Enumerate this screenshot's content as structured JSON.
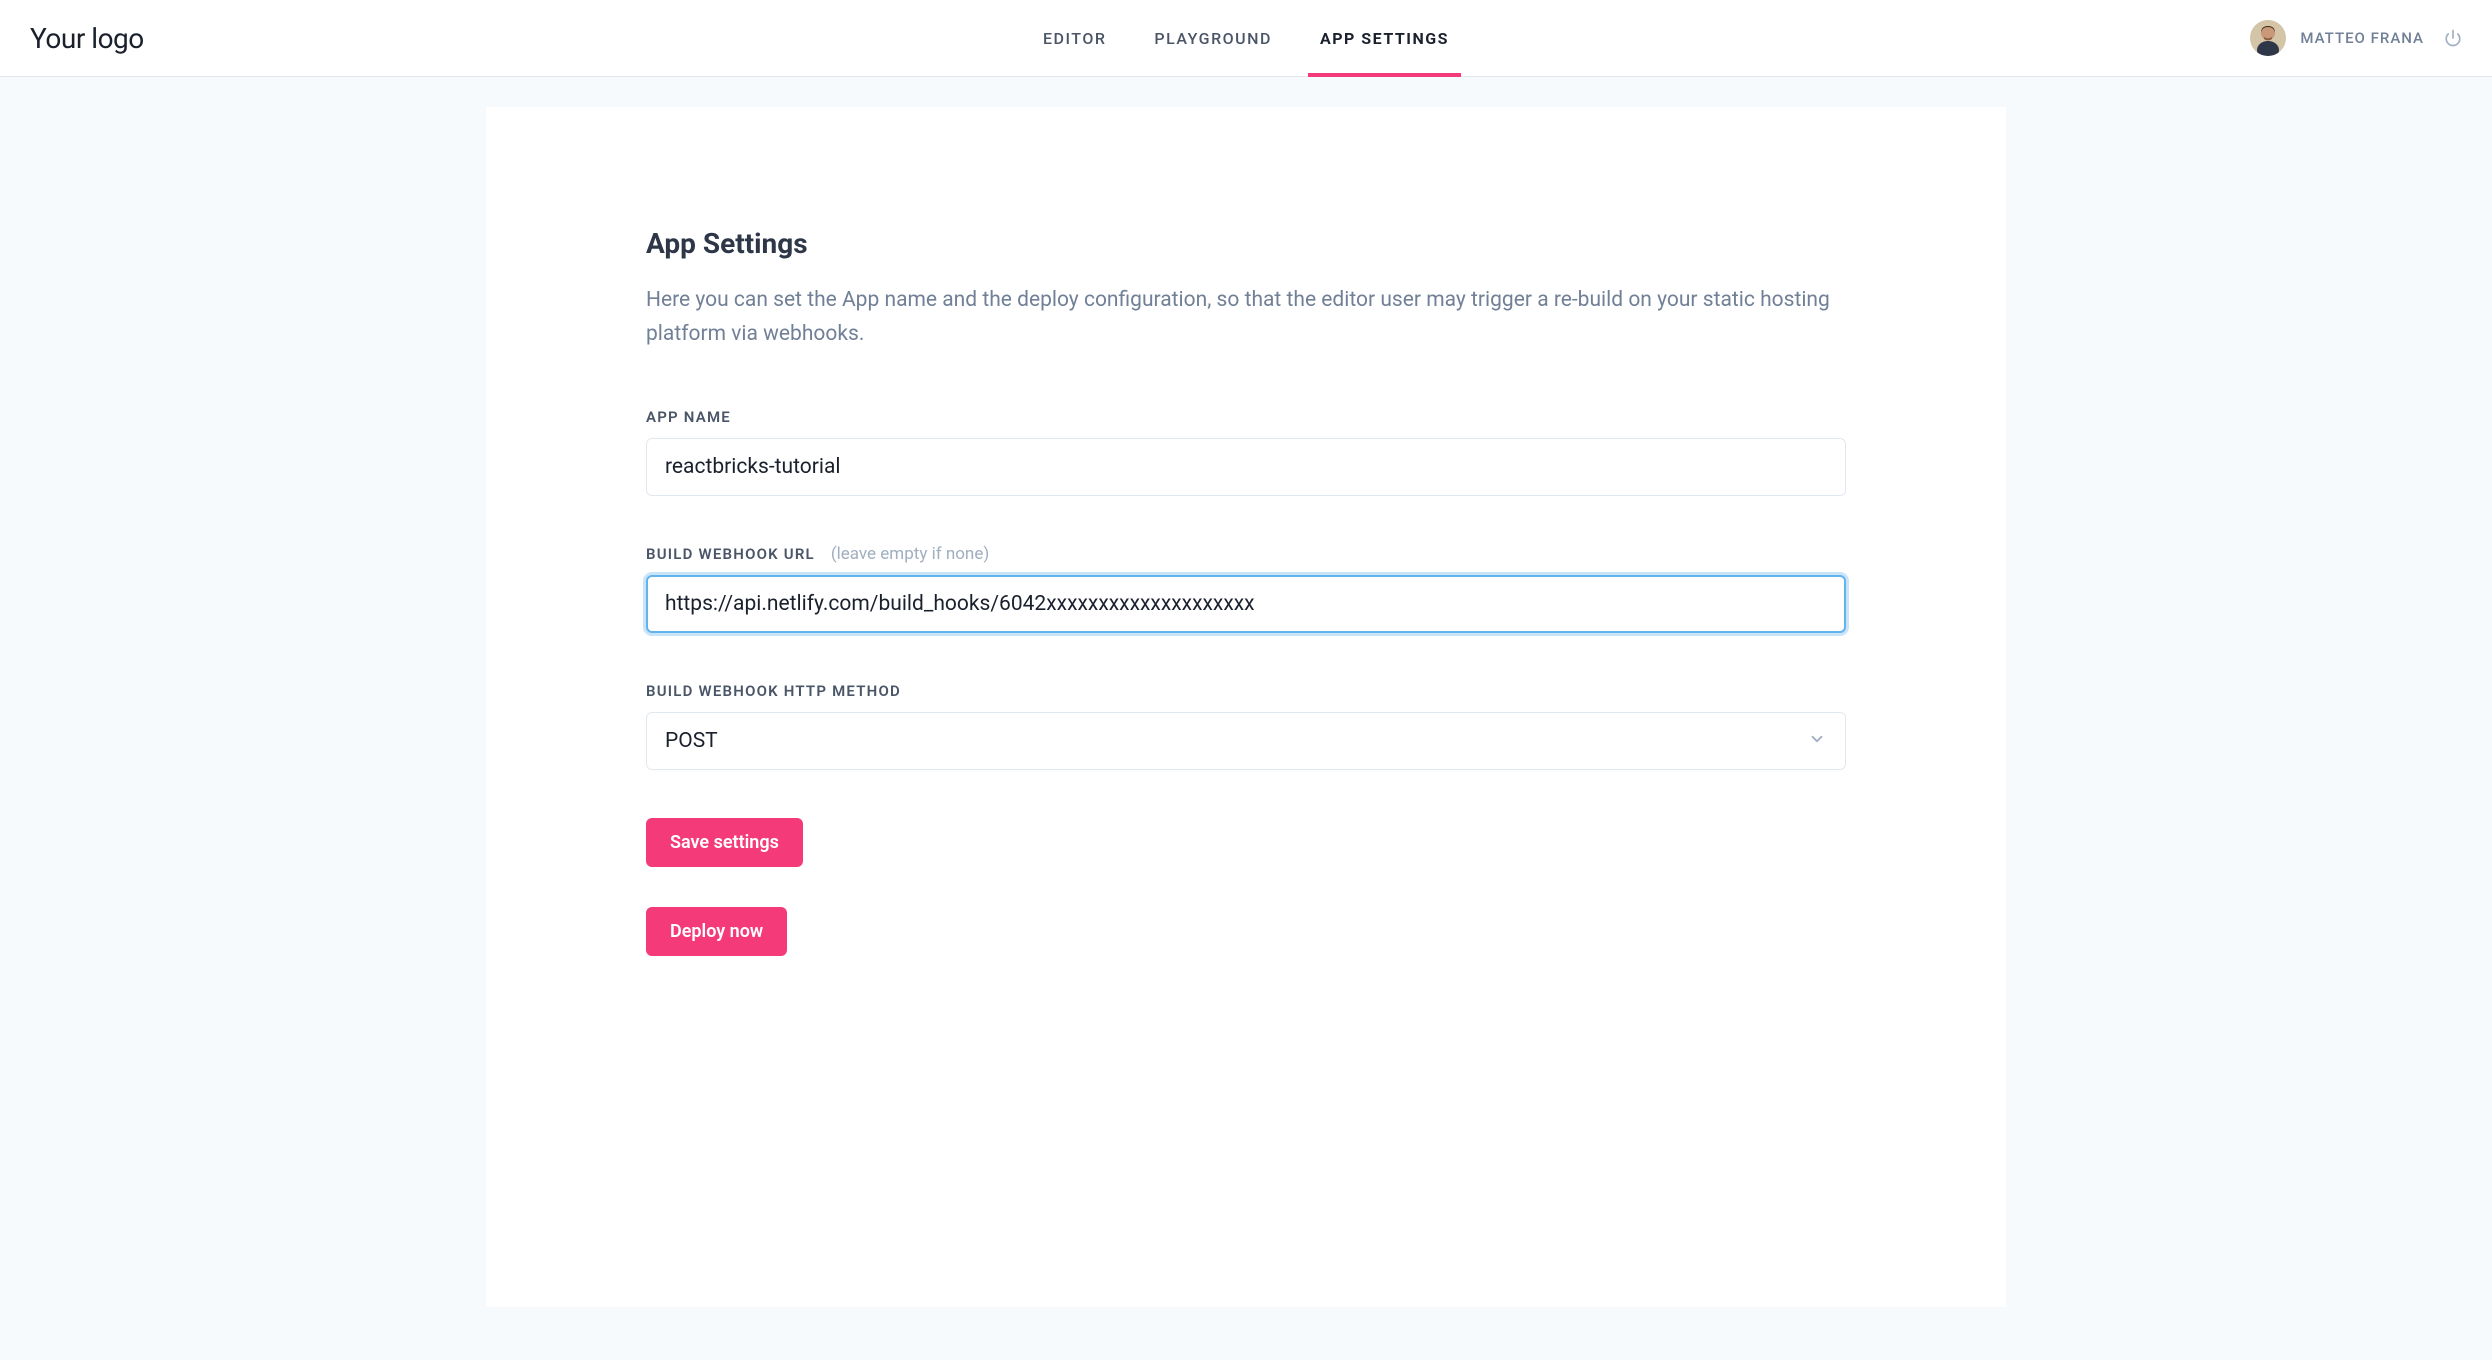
{
  "header": {
    "logo": "Your logo",
    "nav": {
      "editor": "Editor",
      "playground": "Playground",
      "app_settings": "App Settings"
    },
    "user": {
      "name": "MATTEO FRANA"
    }
  },
  "page": {
    "title": "App Settings",
    "description": "Here you can set the App name and the deploy configuration, so that the editor user may trigger a re-build on your static hosting platform via webhooks."
  },
  "form": {
    "app_name": {
      "label": "APP NAME",
      "value": "reactbricks-tutorial"
    },
    "webhook_url": {
      "label": "BUILD WEBHOOK URL",
      "hint": "(leave empty if none)",
      "value": "https://api.netlify.com/build_hooks/6042xxxxxxxxxxxxxxxxxxxx"
    },
    "webhook_method": {
      "label": "BUILD WEBHOOK HTTP METHOD",
      "value": "POST"
    },
    "buttons": {
      "save": "Save settings",
      "deploy": "Deploy now"
    }
  }
}
